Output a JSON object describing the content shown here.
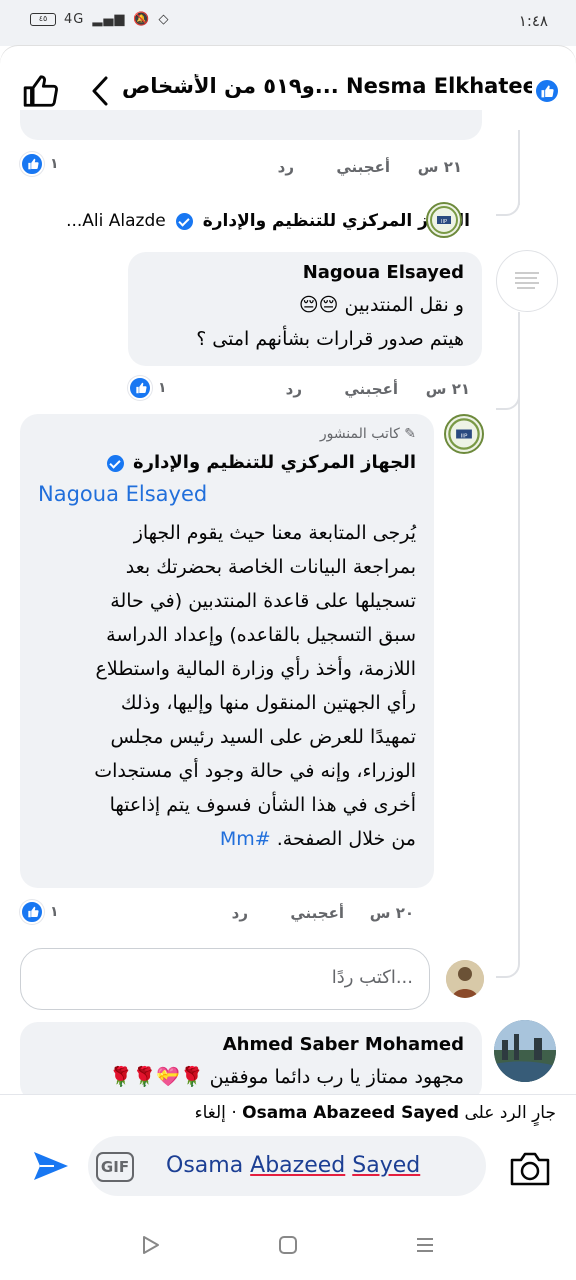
{
  "status": {
    "time": "١:٤٨",
    "battery": "٤٥",
    "network": "4G"
  },
  "header": {
    "title": "و٥١٩ من الأشخاص... Nesma Elkhateeb",
    "icons": [
      "like-outline-icon",
      "chevron-left-icon",
      "like-badge-icon"
    ]
  },
  "previous_comment": {
    "time": "٢١ س",
    "like": "أعجبني",
    "reply": "رد",
    "reactions": "١"
  },
  "reply_hint": {
    "page": "الجهاز المركزي للتنظيم والإدارة",
    "tail": "...Ali Alazde"
  },
  "comment_nagoua": {
    "author": "Nagoua Elsayed",
    "line1": "و نقل المنتدبين 😔😔",
    "line2": "هيتم صدور قرارات بشأنهم امتى ؟",
    "time": "٢١ س",
    "like": "أعجبني",
    "reply": "رد",
    "reactions": "١"
  },
  "comment_page": {
    "badge": "كاتب المنشور",
    "author": "الجهاز المركزي للتنظيم والإدارة",
    "mention": "Nagoua Elsayed",
    "lines": [
      "يُرجى المتابعة معنا حيث يقوم الجهاز",
      "بمراجعة البيانات الخاصة بحضرتك بعد",
      "تسجيلها على قاعدة المنتدبين (في حالة",
      "سبق التسجيل بالقاعده) وإعداد الدراسة",
      "اللازمة، وأخذ رأي وزارة المالية واستطلاع",
      "رأي الجهتين المنقول منها وإليها، وذلك",
      "تمهيدًا للعرض على السيد رئيس مجلس",
      "الوزراء، وإنه في حالة وجود أي مستجدات",
      "أخرى في هذا الشأن فسوف يتم إذاعتها"
    ],
    "last_line": "من خلال الصفحة.",
    "hashtag": "#Mm",
    "time": "٢٠ س",
    "like": "أعجبني",
    "reply": "رد",
    "reactions": "١"
  },
  "reply_input": {
    "placeholder": "اكتب ردًا..."
  },
  "comment_ahmed": {
    "author": "Ahmed Saber Mohamed",
    "text": "مجهود ممتاز يا رب دائما موفقين 🌹💝🌹🌹"
  },
  "compose": {
    "replying_prefix": "جارٍ الرد على",
    "replying_name": "Osama Abazeed Sayed",
    "cancel": "إلغاء",
    "separator": "·",
    "value_first": "Osama",
    "value_second": "Abazeed",
    "value_third": "Sayed",
    "gif": "GIF"
  }
}
